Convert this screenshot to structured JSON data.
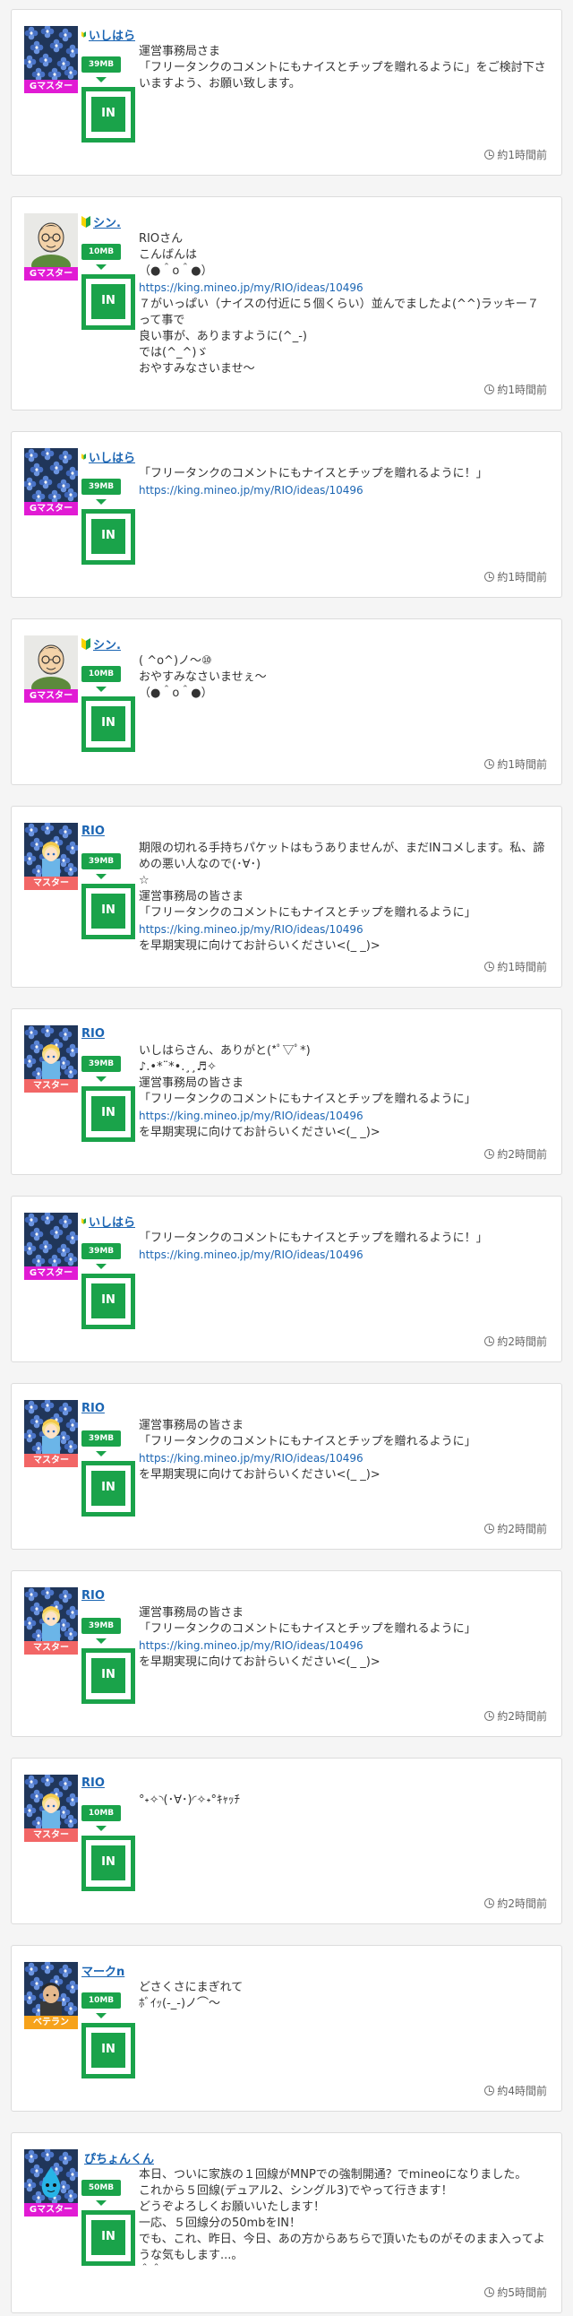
{
  "colors": {
    "accent_green": "#1aa34a",
    "link_blue": "#1b65b3",
    "rank_g_master": "#e11bd4",
    "rank_master": "#f26666",
    "rank_veteran": "#f6a21b"
  },
  "posts": [
    {
      "user": "いしはら",
      "rank": "Gマスター",
      "rank_class": "g",
      "avatar": "flower",
      "beginner": true,
      "mb": "39MB",
      "in_label": "IN",
      "lines": [
        "運営事務局さま",
        "「フリータンクのコメントにもナイスとチップを贈れるように」をご検討下さいますよう、お願い致します。"
      ],
      "time": "約1時間前"
    },
    {
      "user": "シン.",
      "rank": "Gマスター",
      "rank_class": "g",
      "avatar": "man",
      "beginner": true,
      "mb": "10MB",
      "in_label": "IN",
      "lines": [
        "RIOさん",
        "こんばんは",
        "（●＾o＾●）",
        "@https://king.mineo.jp/my/RIO/ideas/10496",
        "７がいっぱい（ナイスの付近に５個くらい）並んでましたよ(^^)ラッキー７って事で",
        "良い事が、ありますように(^_-)",
        "では(^_^)ゞ",
        "おやすみなさいませ〜"
      ],
      "time": "約1時間前"
    },
    {
      "user": "いしはら",
      "rank": "Gマスター",
      "rank_class": "g",
      "avatar": "flower",
      "beginner": true,
      "mb": "39MB",
      "in_label": "IN",
      "lines": [
        "「フリータンクのコメントにもナイスとチップを贈れるように！」",
        "@https://king.mineo.jp/my/RIO/ideas/10496"
      ],
      "time": "約1時間前"
    },
    {
      "user": "シン.",
      "rank": "Gマスター",
      "rank_class": "g",
      "avatar": "man",
      "beginner": true,
      "mb": "10MB",
      "in_label": "IN",
      "lines": [
        "( ^o^)ノ〜⑩",
        "おやすみなさいませぇ〜",
        "（●＾o＾●）"
      ],
      "time": "約1時間前"
    },
    {
      "user": "RIO",
      "rank": "マスター",
      "rank_class": "m",
      "avatar": "flower-girl",
      "beginner": false,
      "mb": "39MB",
      "in_label": "IN",
      "lines": [
        "期限の切れる手持ちパケットはもうありませんが、まだINコメします。私、諦めの悪い人なので(･∀･)",
        "☆",
        "運営事務局の皆さま",
        "「フリータンクのコメントにもナイスとチップを贈れるように」",
        "@https://king.mineo.jp/my/RIO/ideas/10496",
        "を早期実現に向けてお計らいください<(_ _)>"
      ],
      "time": "約1時間前"
    },
    {
      "user": "RIO",
      "rank": "マスター",
      "rank_class": "m",
      "avatar": "flower-girl",
      "beginner": false,
      "mb": "39MB",
      "in_label": "IN",
      "lines": [
        "いしはらさん、ありがと(*ﾟ▽ﾟ*)",
        "♪.•*¨*•.¸¸♬✧",
        "運営事務局の皆さま",
        "「フリータンクのコメントにもナイスとチップを贈れるように」",
        "@https://king.mineo.jp/my/RIO/ideas/10496",
        "を早期実現に向けてお計らいください<(_ _)>"
      ],
      "time": "約2時間前"
    },
    {
      "user": "いしはら",
      "rank": "Gマスター",
      "rank_class": "g",
      "avatar": "flower",
      "beginner": true,
      "mb": "39MB",
      "in_label": "IN",
      "lines": [
        "「フリータンクのコメントにもナイスとチップを贈れるように！」",
        "@https://king.mineo.jp/my/RIO/ideas/10496"
      ],
      "time": "約2時間前"
    },
    {
      "user": "RIO",
      "rank": "マスター",
      "rank_class": "m",
      "avatar": "flower-girl",
      "beginner": false,
      "mb": "39MB",
      "in_label": "IN",
      "lines": [
        "運営事務局の皆さま",
        "「フリータンクのコメントにもナイスとチップを贈れるように」",
        "@https://king.mineo.jp/my/RIO/ideas/10496",
        "を早期実現に向けてお計らいください<(_ _)>"
      ],
      "time": "約2時間前"
    },
    {
      "user": "RIO",
      "rank": "マスター",
      "rank_class": "m",
      "avatar": "flower-girl",
      "beginner": false,
      "mb": "39MB",
      "in_label": "IN",
      "lines": [
        "運営事務局の皆さま",
        "「フリータンクのコメントにもナイスとチップを贈れるように」",
        "@https://king.mineo.jp/my/RIO/ideas/10496",
        "を早期実現に向けてお計らいください<(_ _)>"
      ],
      "time": "約2時間前"
    },
    {
      "user": "RIO",
      "rank": "マスター",
      "rank_class": "m",
      "avatar": "flower-girl",
      "beginner": false,
      "mb": "10MB",
      "in_label": "IN",
      "lines": [
        "°˖✧◝(･∀･)◜✧˖°ｷｬｯﾁ"
      ],
      "time": "約2時間前"
    },
    {
      "user": "マークn",
      "rank": "ベテラン",
      "rank_class": "v",
      "avatar": "flower-boy",
      "beginner": false,
      "mb": "10MB",
      "in_label": "IN",
      "lines": [
        "どさくさにまぎれて",
        "ﾎﾞｲｯ(-_-)ノ⌒〜"
      ],
      "time": "約4時間前"
    },
    {
      "user": "ぴちょんくん",
      "rank": "Gマスター",
      "rank_class": "g",
      "avatar": "flower-drop",
      "beginner": true,
      "mb": "50MB",
      "in_label": "IN",
      "lines": [
        "本日、ついに家族の１回線がMNPでの強制開通？でmineoになりました。",
        "これから５回線(デュアル2、シングル3)でやって行きます！",
        "どうぞよろしくお願いいたします！",
        "一応、５回線分の50mbをIN！",
        "でも、これ、昨日、今日、あの方からあちらで頂いたものがそのまま入ってような気もします...。",
        "＾＾"
      ],
      "time": "約5時間前"
    }
  ]
}
